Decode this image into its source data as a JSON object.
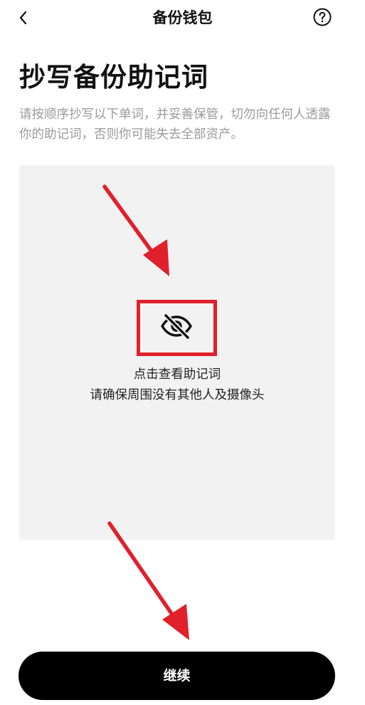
{
  "header": {
    "title": "备份钱包",
    "back_icon": "chevron-left-icon",
    "help_icon": "question-circle-icon"
  },
  "main": {
    "title": "抄写备份助记词",
    "description": "请按顺序抄写以下单词，并妥善保管，切勿向任何人透露你的助记词，否则你可能失去全部资产。",
    "reveal": {
      "icon": "eye-slash-icon",
      "line1": "点击查看助记词",
      "line2": "请确保周围没有其他人及摄像头"
    }
  },
  "footer": {
    "continue_label": "继续"
  },
  "colors": {
    "background": "#ffffff",
    "panel": "#f2f2f2",
    "primary_button": "#000000",
    "annotation_red": "#e0202a",
    "muted_text": "#9a9a9a"
  }
}
